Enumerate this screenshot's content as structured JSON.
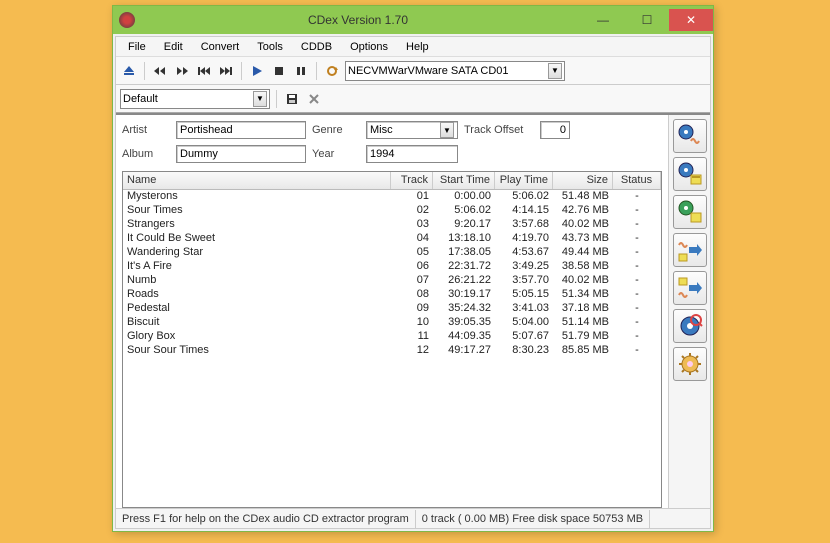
{
  "window": {
    "title": "CDex Version 1.70"
  },
  "menus": [
    "File",
    "Edit",
    "Convert",
    "Tools",
    "CDDB",
    "Options",
    "Help"
  ],
  "drive": "NECVMWarVMware SATA CD01",
  "profile": "Default",
  "fields": {
    "artist_label": "Artist",
    "artist": "Portishead",
    "album_label": "Album",
    "album": "Dummy",
    "genre_label": "Genre",
    "genre": "Misc",
    "year_label": "Year",
    "year": "1994",
    "offset_label": "Track Offset",
    "offset": "0"
  },
  "columns": {
    "name": "Name",
    "track": "Track",
    "start": "Start Time",
    "play": "Play Time",
    "size": "Size",
    "status": "Status"
  },
  "tracks": [
    {
      "name": "Mysterons",
      "track": "01",
      "start": "0:00.00",
      "play": "5:06.02",
      "size": "51.48 MB",
      "status": "-"
    },
    {
      "name": "Sour Times",
      "track": "02",
      "start": "5:06.02",
      "play": "4:14.15",
      "size": "42.76 MB",
      "status": "-"
    },
    {
      "name": "Strangers",
      "track": "03",
      "start": "9:20.17",
      "play": "3:57.68",
      "size": "40.02 MB",
      "status": "-"
    },
    {
      "name": "It Could Be Sweet",
      "track": "04",
      "start": "13:18.10",
      "play": "4:19.70",
      "size": "43.73 MB",
      "status": "-"
    },
    {
      "name": "Wandering Star",
      "track": "05",
      "start": "17:38.05",
      "play": "4:53.67",
      "size": "49.44 MB",
      "status": "-"
    },
    {
      "name": "It's A Fire",
      "track": "06",
      "start": "22:31.72",
      "play": "3:49.25",
      "size": "38.58 MB",
      "status": "-"
    },
    {
      "name": "Numb",
      "track": "07",
      "start": "26:21.22",
      "play": "3:57.70",
      "size": "40.02 MB",
      "status": "-"
    },
    {
      "name": "Roads",
      "track": "08",
      "start": "30:19.17",
      "play": "5:05.15",
      "size": "51.34 MB",
      "status": "-"
    },
    {
      "name": "Pedestal",
      "track": "09",
      "start": "35:24.32",
      "play": "3:41.03",
      "size": "37.18 MB",
      "status": "-"
    },
    {
      "name": "Biscuit",
      "track": "10",
      "start": "39:05.35",
      "play": "5:04.00",
      "size": "51.14 MB",
      "status": "-"
    },
    {
      "name": "Glory Box",
      "track": "11",
      "start": "44:09.35",
      "play": "5:07.67",
      "size": "51.79 MB",
      "status": "-"
    },
    {
      "name": "Sour Sour Times",
      "track": "12",
      "start": "49:17.27",
      "play": "8:30.23",
      "size": "85.85 MB",
      "status": "-"
    }
  ],
  "status": {
    "help": "Press F1 for help on the CDex audio CD extractor program",
    "disk": "0 track ( 0.00 MB) Free disk space 50753 MB"
  }
}
